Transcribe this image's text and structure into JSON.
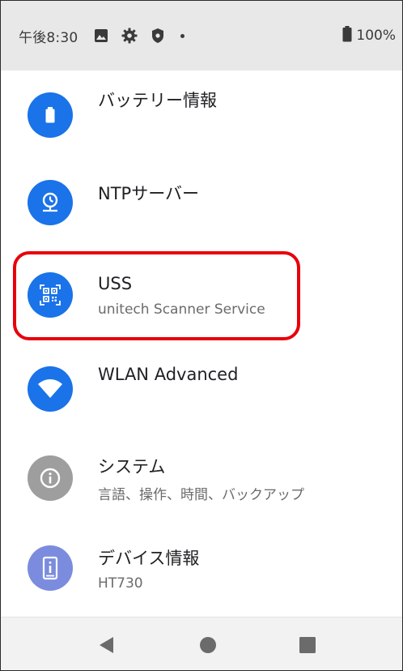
{
  "status_bar": {
    "time": "午後8:30",
    "battery_percent": "100%",
    "icons": [
      "image-icon",
      "gear-icon",
      "shield-icon",
      "dot-icon"
    ]
  },
  "settings_list": [
    {
      "title": "バッテリー情報",
      "subtitle": "",
      "icon": "battery-icon",
      "icon_color": "#1a73e8"
    },
    {
      "title": "NTPサーバー",
      "subtitle": "",
      "icon": "clock-network-icon",
      "icon_color": "#1a73e8"
    },
    {
      "title": "USS",
      "subtitle": "unitech Scanner Service",
      "icon": "qr-scanner-icon",
      "icon_color": "#1a73e8"
    },
    {
      "title": "WLAN Advanced",
      "subtitle": "",
      "icon": "wifi-icon",
      "icon_color": "#1a73e8"
    },
    {
      "title": "システム",
      "subtitle": "言語、操作、時間、バックアップ",
      "icon": "info-icon",
      "icon_color": "#9e9e9e"
    },
    {
      "title": "デバイス情報",
      "subtitle": "HT730",
      "icon": "device-icon",
      "icon_color": "#7b8cde"
    }
  ],
  "highlight": {
    "target": "USS",
    "color": "#e8000b"
  },
  "nav_bar": {
    "buttons": [
      "back-button",
      "home-button",
      "recents-button"
    ]
  }
}
